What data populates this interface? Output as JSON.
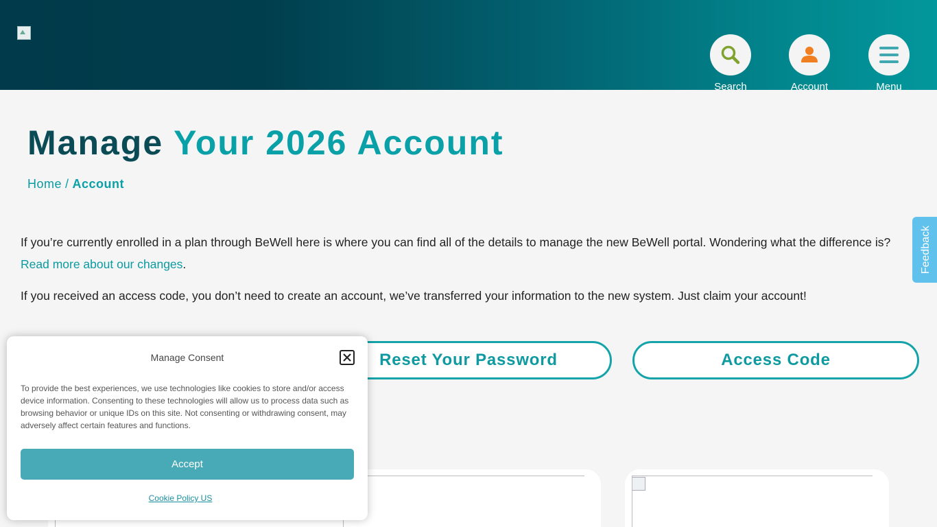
{
  "header": {
    "nav": [
      {
        "label": "Search",
        "icon": "search-icon"
      },
      {
        "label": "Account",
        "icon": "account-icon"
      },
      {
        "label": "Menu",
        "icon": "menu-icon"
      }
    ]
  },
  "page": {
    "title_part1": "Manage",
    "title_part2": "Your 2026 Account",
    "breadcrumb": {
      "home": "Home",
      "separator": "/",
      "current": "Account"
    },
    "intro_text": "If you’re currently enrolled in a plan through BeWell here is where you can find all of the details to manage the new BeWell portal. Wondering what the difference is?",
    "intro_link": "Read more about our changes",
    "intro_link_suffix": ".",
    "access_text": "If you received an access code, you don’t need to create an account, we’ve transferred your information to the new system. Just claim your account!",
    "buttons": {
      "reset_password": "Reset Your Password",
      "access_code": "Access Code"
    }
  },
  "feedback": {
    "label": "Feedback"
  },
  "consent": {
    "title": "Manage Consent",
    "body": "To provide the best experiences, we use technologies like cookies to store and/or access device information. Consenting to these technologies will allow us to process data such as browsing behavior or unique IDs on this site. Not consenting or withdrawing consent, may adversely affect certain features and functions.",
    "accept_label": "Accept",
    "policy_link": "Cookie Policy US"
  },
  "colors": {
    "header_dark": "#013a4a",
    "header_teal": "#02979c",
    "accent": "#0aa0a8",
    "accept": "#48aab6",
    "feedback": "#5fc1ec"
  }
}
